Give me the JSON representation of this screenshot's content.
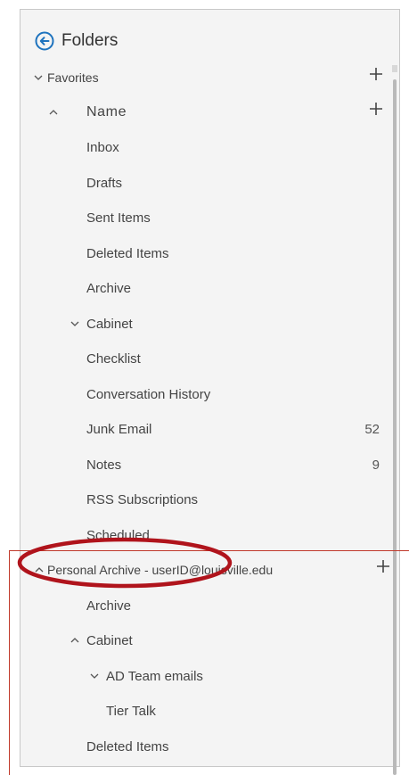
{
  "header": {
    "title": "Folders"
  },
  "favorites": {
    "label": "Favorites"
  },
  "account": {
    "label": "Name"
  },
  "folders": [
    {
      "label": "Inbox",
      "count": ""
    },
    {
      "label": "Drafts",
      "count": ""
    },
    {
      "label": "Sent Items",
      "count": ""
    },
    {
      "label": "Deleted Items",
      "count": ""
    },
    {
      "label": "Archive",
      "count": ""
    },
    {
      "label": "Cabinet",
      "count": ""
    },
    {
      "label": "Checklist",
      "count": ""
    },
    {
      "label": "Conversation History",
      "count": ""
    },
    {
      "label": "Junk Email",
      "count": "52"
    },
    {
      "label": "Notes",
      "count": "9"
    },
    {
      "label": "RSS Subscriptions",
      "count": ""
    },
    {
      "label": "Scheduled",
      "count": ""
    }
  ],
  "personal_archive": {
    "label_prefix": "Personal Archive - ",
    "label_email": "userID@louisville.edu",
    "children": [
      {
        "label": "Archive"
      },
      {
        "label": "Cabinet"
      },
      {
        "label": "AD Team emails"
      },
      {
        "label": "Tier Talk"
      },
      {
        "label": "Deleted Items"
      }
    ]
  },
  "colors": {
    "accent": "#1e73be",
    "annotation": "#c0392b",
    "annotation_ellipse": "#b0141c"
  }
}
